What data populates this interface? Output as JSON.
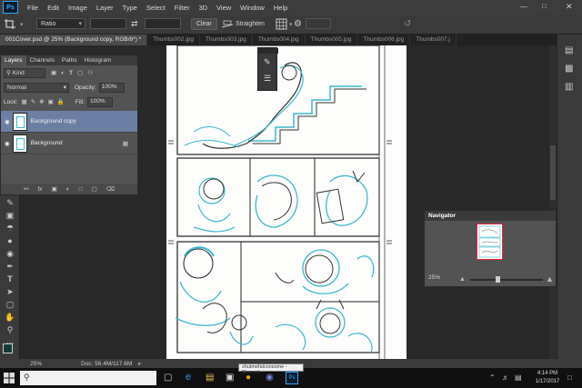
{
  "menubar": {
    "logo": "Ps",
    "items": [
      "File",
      "Edit",
      "Image",
      "Layer",
      "Type",
      "Select",
      "Filter",
      "3D",
      "View",
      "Window",
      "Help"
    ]
  },
  "options": {
    "ratio_value": "Ratio",
    "clear_label": "Clear",
    "straighten_label": "Straighten"
  },
  "tabs": [
    {
      "label": "001Cover.psd @ 25% (Background copy, RGB/8*) *",
      "active": true
    },
    {
      "label": "Thumbs002.jpg",
      "active": false
    },
    {
      "label": "Thumbs003.jpg",
      "active": false
    },
    {
      "label": "Thumbs004.jpg",
      "active": false
    },
    {
      "label": "Thumbs005.jpg",
      "active": false
    },
    {
      "label": "Thumbs006.jpg",
      "active": false
    },
    {
      "label": "Thumbs007.j",
      "active": false
    }
  ],
  "layers_panel": {
    "tabs": [
      "Layers",
      "Channels",
      "Paths",
      "Histogram"
    ],
    "filter_label": "Kind",
    "blend_mode": "Normal",
    "opacity_label": "Opacity:",
    "opacity_value": "100%",
    "lock_label": "Lock:",
    "fill_label": "Fill:",
    "fill_value": "100%",
    "layers": [
      {
        "name": "Background copy",
        "selected": true
      },
      {
        "name": "Background",
        "selected": false
      }
    ]
  },
  "navigator": {
    "title": "Navigator",
    "zoom": "25%"
  },
  "status": {
    "zoom": "25%",
    "doc": "Doc: 56.4M/117.6M"
  },
  "tooltip": "shutmefalconsome - Discord",
  "taskbar": {
    "time": "4:14 PM",
    "date": "1/17/2017"
  },
  "colors": {
    "accent": "#31a8ff",
    "panel": "#535353",
    "selected_layer": "#6b7fa3",
    "sketch_blue": "#3bb8cf"
  }
}
